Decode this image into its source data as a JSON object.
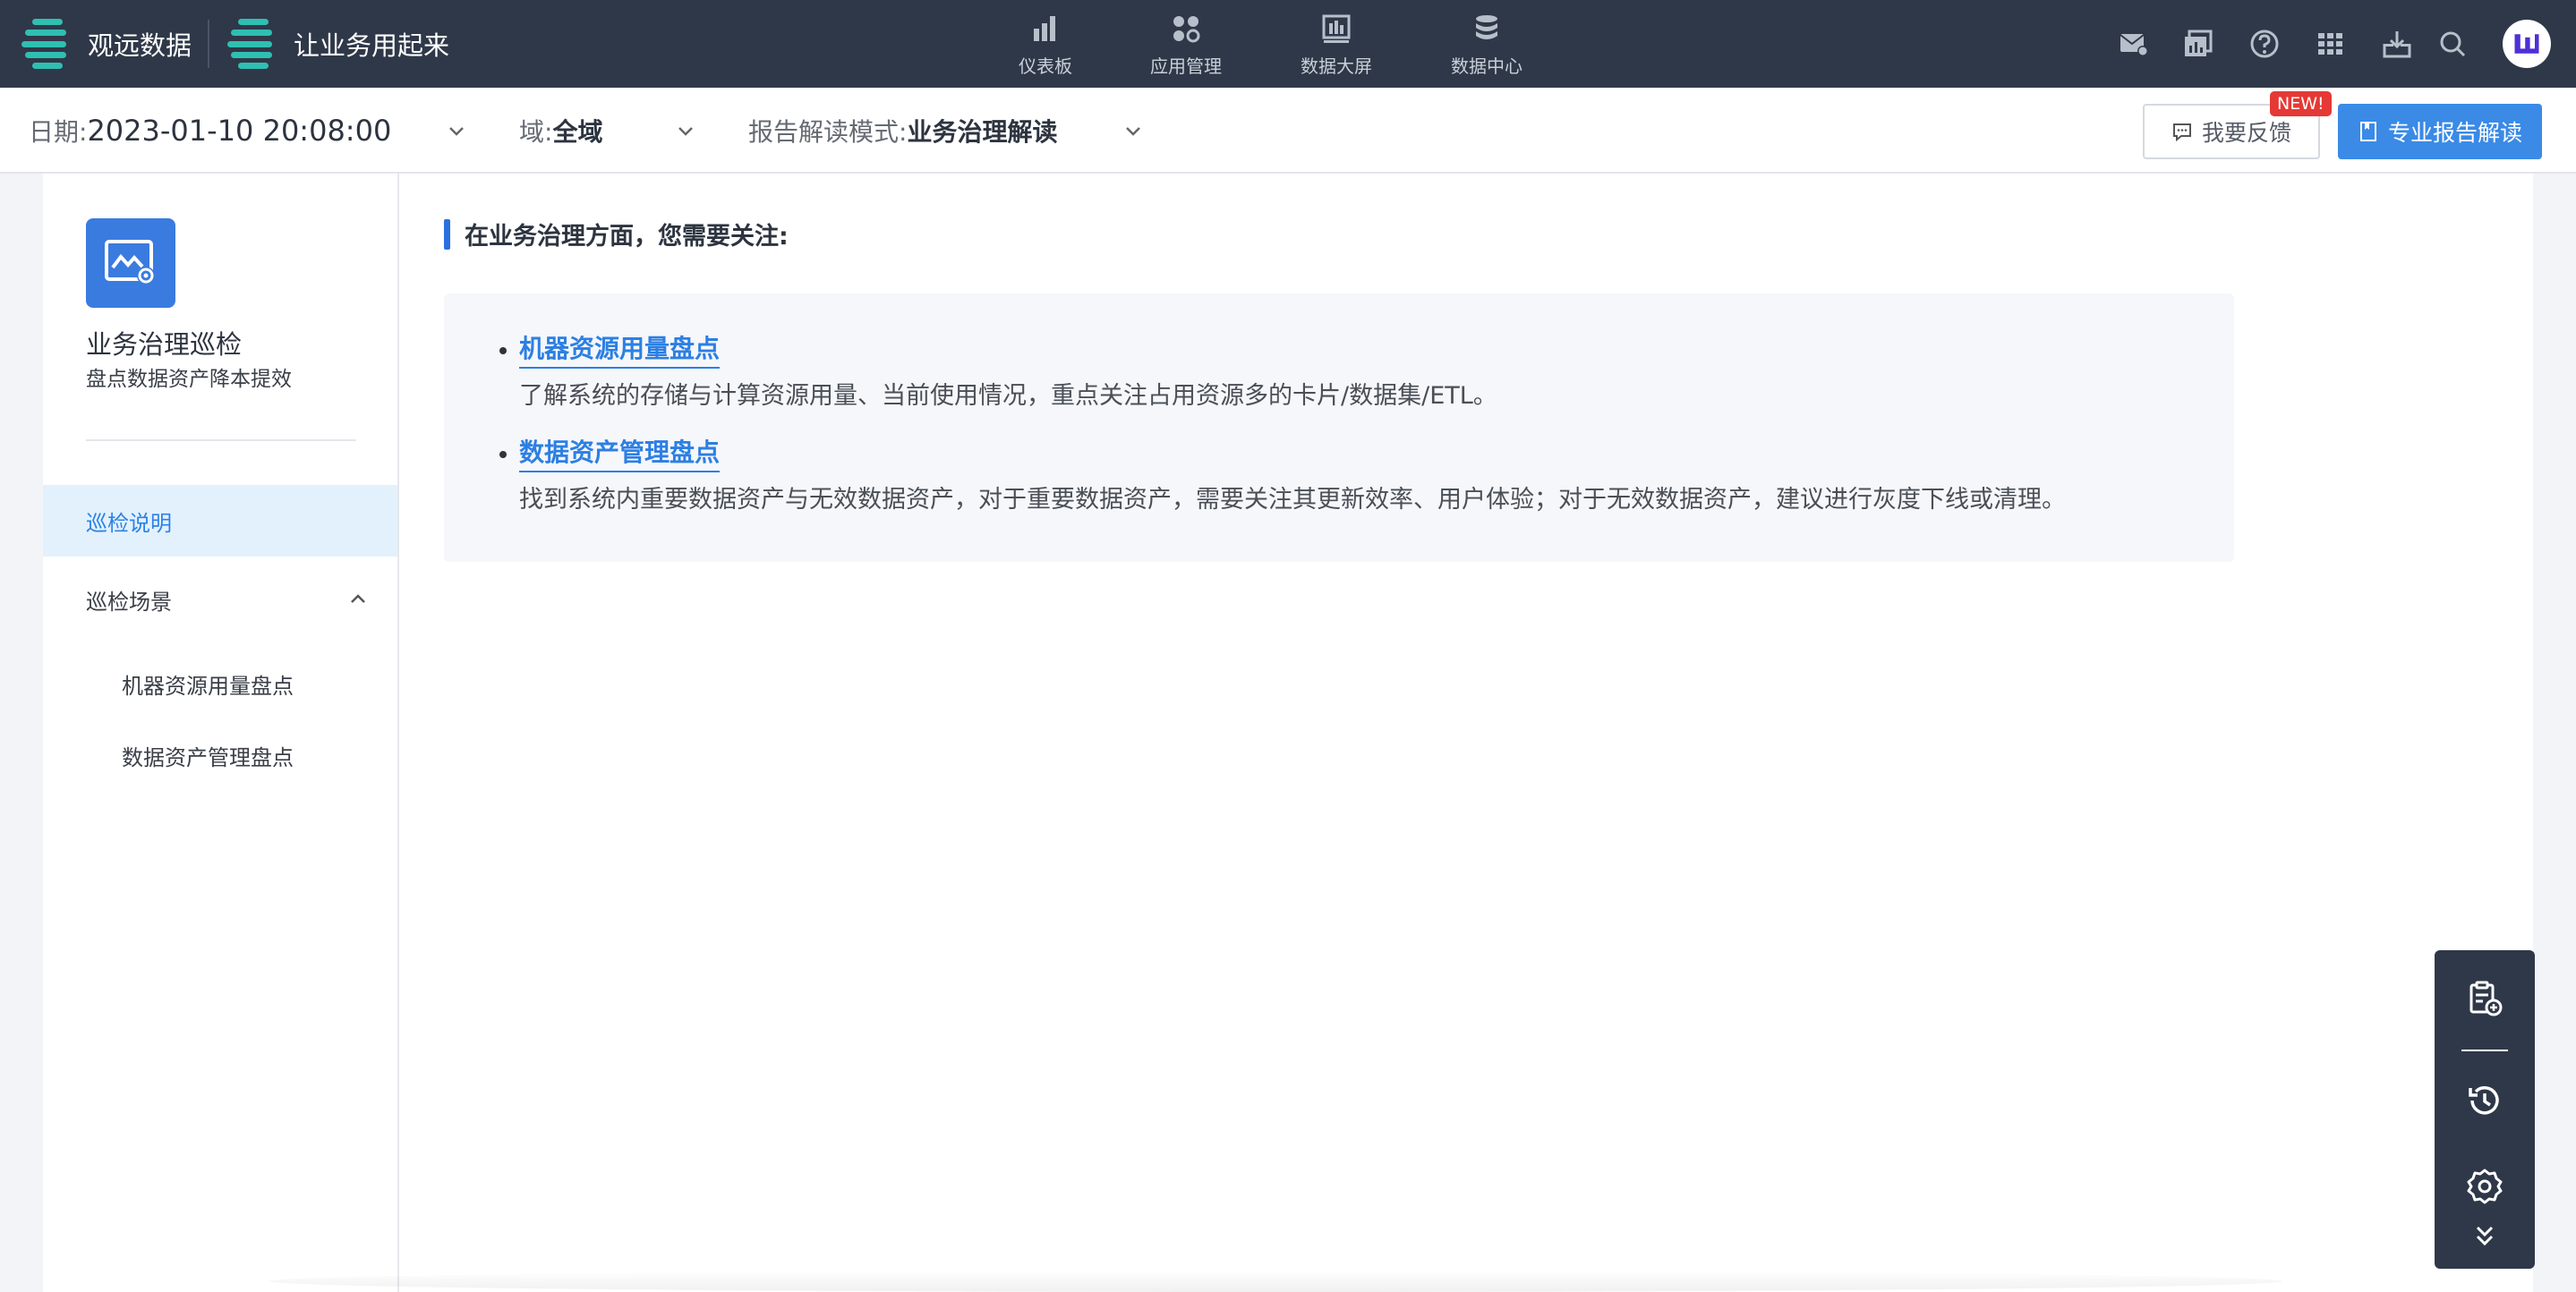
{
  "topnav": {
    "brand_primary": "观远数据",
    "brand_secondary": "让业务用起来",
    "items": [
      {
        "label": "仪表板",
        "icon": "bar-chart-icon"
      },
      {
        "label": "应用管理",
        "icon": "apps-icon"
      },
      {
        "label": "数据大屏",
        "icon": "screen-icon"
      },
      {
        "label": "数据中心",
        "icon": "database-icon"
      }
    ],
    "tools": [
      "mail-icon",
      "report-icon",
      "help-icon",
      "grid-icon",
      "download-icon",
      "search-icon"
    ]
  },
  "filters": {
    "date_label": "日期:",
    "date_value": "2023-01-10 20:08:00",
    "domain_label": "域:",
    "domain_value": "全域",
    "mode_label": "报告解读模式:",
    "mode_value": "业务治理解读"
  },
  "actions": {
    "feedback_label": "我要反馈",
    "new_badge": "NEW!",
    "report_label": "专业报告解读"
  },
  "sidebar": {
    "title": "业务治理巡检",
    "subtitle": "盘点数据资产降本提效",
    "items": [
      {
        "label": "巡检说明",
        "active": true
      },
      {
        "label": "巡检场景",
        "expanded": true,
        "children": [
          "机器资源用量盘点",
          "数据资产管理盘点"
        ]
      }
    ]
  },
  "content": {
    "heading": "在业务治理方面，您需要关注:",
    "items": [
      {
        "title": "机器资源用量盘点",
        "desc": "了解系统的存储与计算资源用量、当前使用情况，重点关注占用资源多的卡片/数据集/ETL。"
      },
      {
        "title": "数据资产管理盘点",
        "desc": "找到系统内重要数据资产与无效数据资产，对于重要数据资产，需要关注其更新效率、用户体验；对于无效数据资产，建议进行灰度下线或清理。"
      }
    ]
  },
  "floating_toolbar": [
    "clipboard-add-icon",
    "history-icon",
    "settings-icon",
    "double-chevron-down-icon"
  ],
  "colors": {
    "nav_bg": "#2f3848",
    "accent": "#3a8ae6",
    "brand_teal": "#2fbfb2",
    "active_bg": "#e3f1fd",
    "badge_red": "#e53935"
  }
}
